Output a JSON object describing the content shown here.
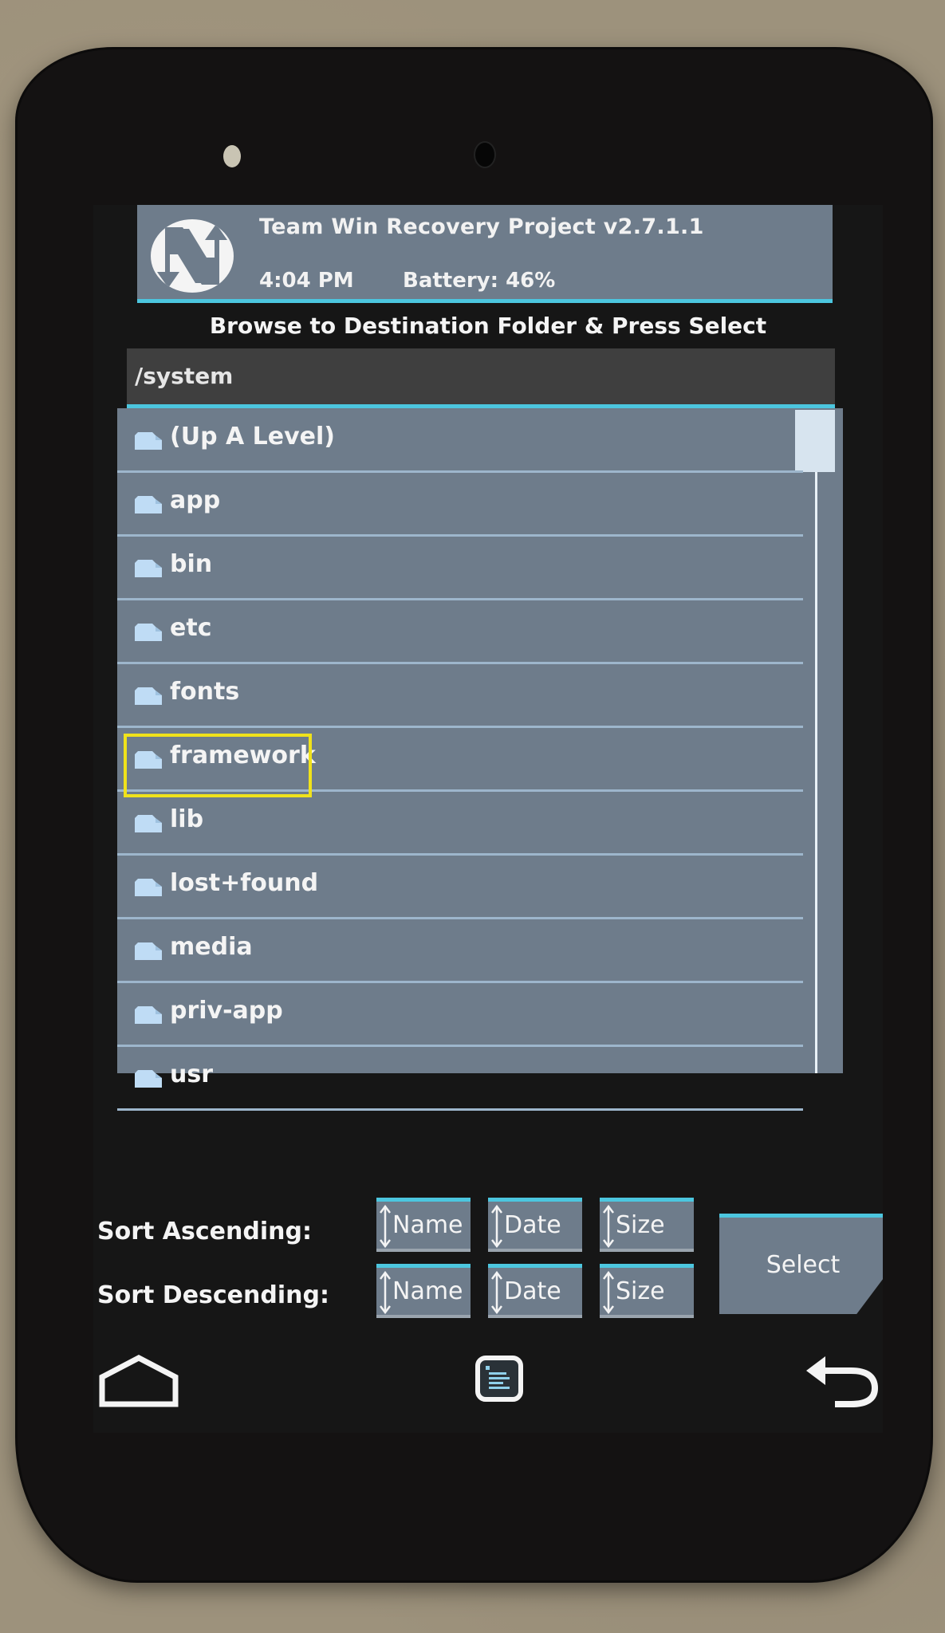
{
  "header": {
    "title": "Team Win Recovery Project  v2.7.1.1",
    "time": "4:04 PM",
    "battery": "Battery: 46%"
  },
  "prompt": "Browse to Destination Folder & Press Select",
  "current_path": "/system",
  "folders": [
    {
      "label": "(Up A Level)"
    },
    {
      "label": "app"
    },
    {
      "label": "bin"
    },
    {
      "label": "etc"
    },
    {
      "label": "fonts"
    },
    {
      "label": "framework",
      "highlighted": true
    },
    {
      "label": "lib"
    },
    {
      "label": "lost+found"
    },
    {
      "label": "media"
    },
    {
      "label": "priv-app"
    },
    {
      "label": "usr"
    }
  ],
  "sort": {
    "ascending_label": "Sort Ascending:",
    "descending_label": "Sort Descending:",
    "ascending_buttons": [
      "Name",
      "Date",
      "Size"
    ],
    "descending_buttons": [
      "Name",
      "Date",
      "Size"
    ]
  },
  "select_label": "Select",
  "nav": {
    "home": "home-icon",
    "console": "console-icon",
    "back": "back-icon"
  },
  "colors": {
    "accent": "#4cc6df",
    "panel": "#6e7c8b",
    "highlight": "#f0e21b",
    "folder": "#bfdcf5"
  }
}
